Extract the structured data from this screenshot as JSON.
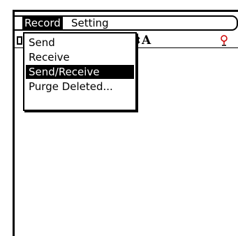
{
  "menubar": {
    "menus": [
      {
        "label": "Record"
      },
      {
        "label": "Setting"
      }
    ],
    "active_menu": "Record"
  },
  "toolbar": {
    "arrow_glyph": "⇕",
    "font_glyph": "A",
    "priority_icon": "priority-icon"
  },
  "dropdown": {
    "items": [
      {
        "label": "Send"
      },
      {
        "label": "Receive"
      },
      {
        "label": "Send/Receive"
      },
      {
        "label": "Purge Deleted..."
      }
    ],
    "selected_index": 2
  }
}
